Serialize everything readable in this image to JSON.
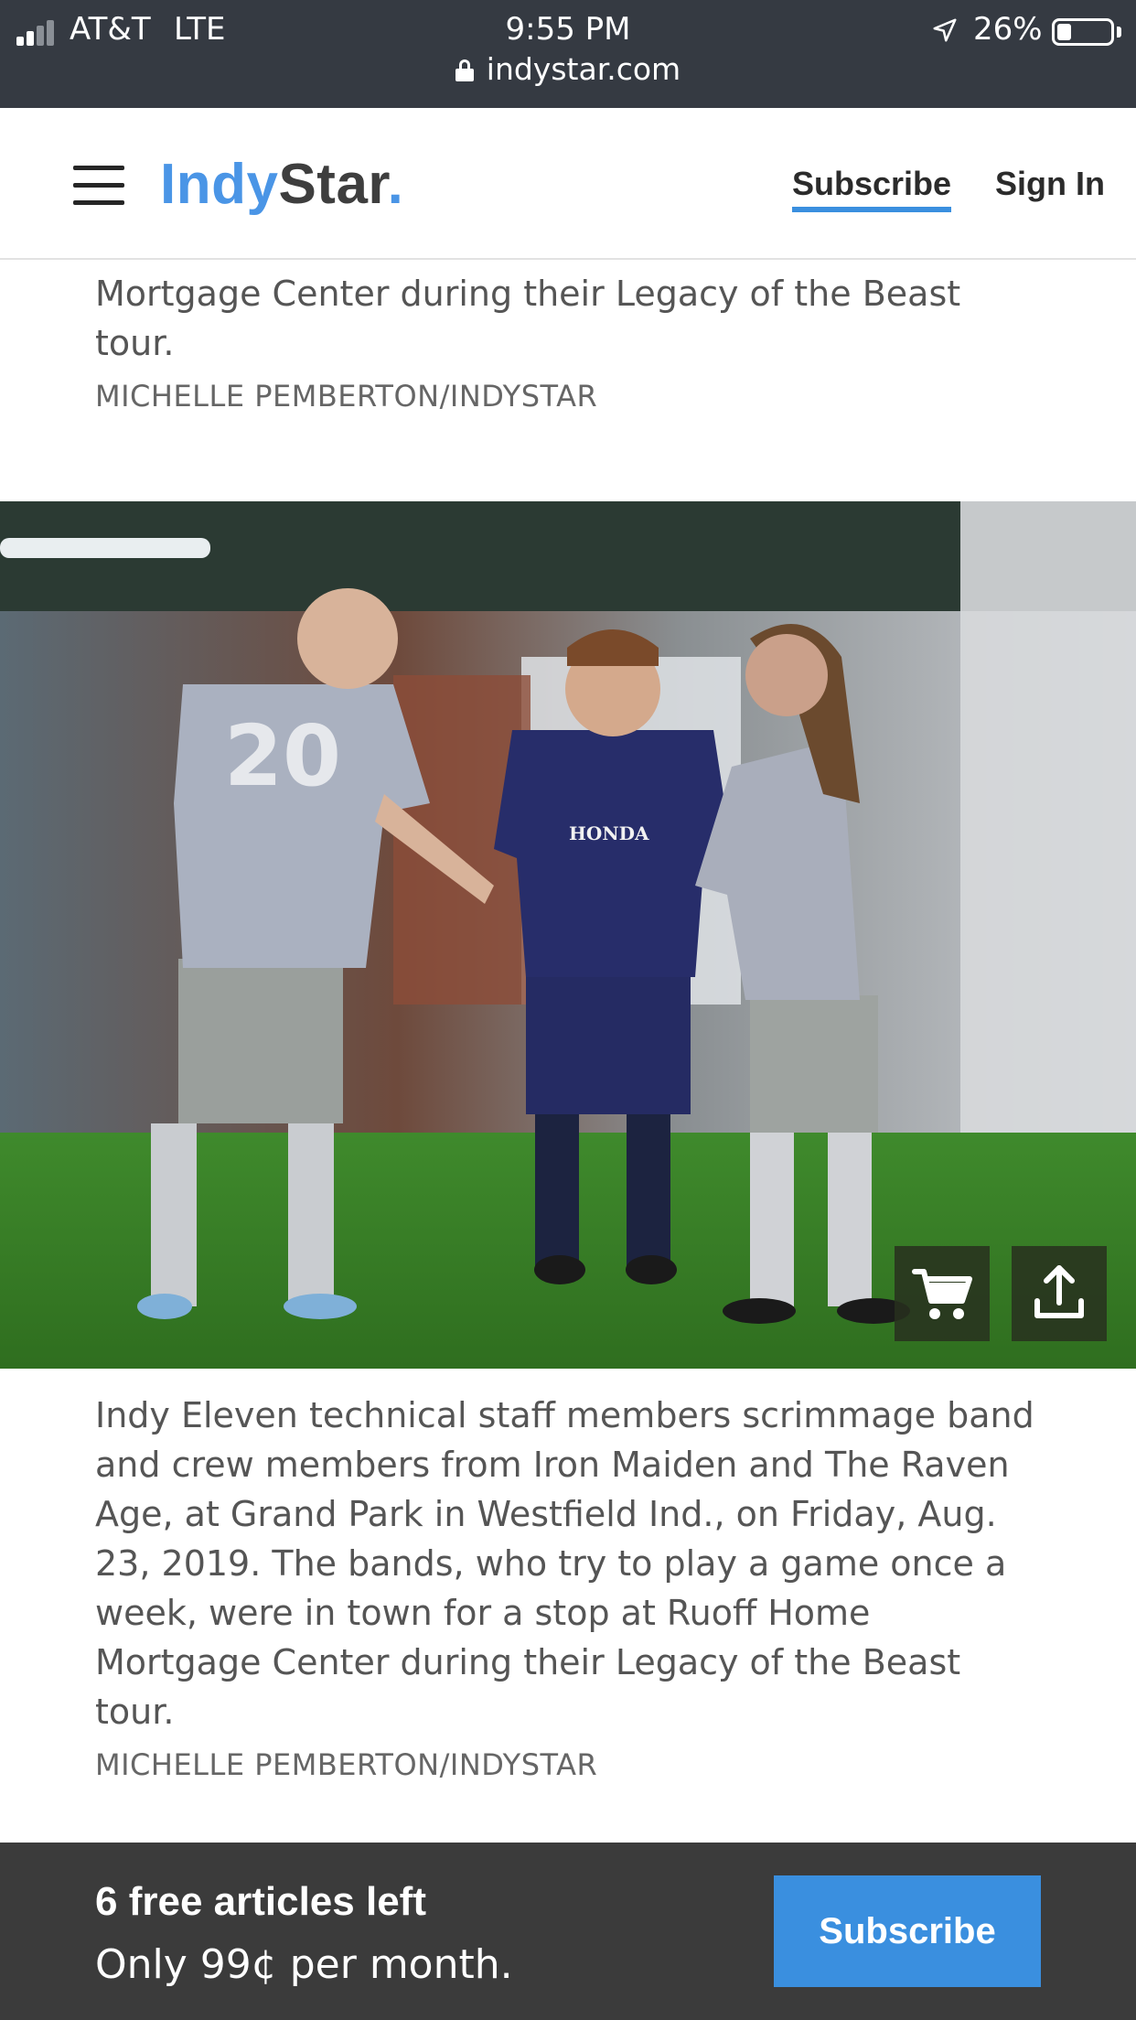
{
  "status_bar": {
    "carrier": "AT&T",
    "network": "LTE",
    "time": "9:55 PM",
    "battery_percent": "26%",
    "battery_level": 0.26,
    "signal_bars_active": 2,
    "signal_bars_total": 4
  },
  "browser": {
    "url": "indystar.com"
  },
  "header": {
    "logo_part1": "Indy",
    "logo_part2": "Star",
    "logo_dot": ".",
    "subscribe_label": "Subscribe",
    "signin_label": "Sign In"
  },
  "article": {
    "prev_caption_tail": "Mortgage Center during their Legacy of the Beast tour.",
    "prev_credit": "MICHELLE PEMBERTON/INDYSTAR",
    "photo": {
      "jersey_number": "20",
      "sponsor_text": "HONDA"
    },
    "caption": "Indy Eleven technical staff members scrimmage band and crew members from Iron Maiden and The Raven Age, at Grand Park in Westfield Ind., on Friday, Aug. 23, 2019. The bands, who try to play a game once a week, were in town for a stop at Ruoff Home Mortgage Center during their Legacy of the Beast tour.",
    "credit": "MICHELLE PEMBERTON/INDYSTAR"
  },
  "paywall": {
    "title": "6 free articles left",
    "subtitle": "Only 99¢ per month.",
    "button_label": "Subscribe"
  },
  "colors": {
    "brand_blue": "#4a95e6",
    "status_bar_bg": "#353a42",
    "paywall_bg": "#3b3b3b",
    "button_blue": "#3a8fdf"
  },
  "icons": {
    "menu": "menu-icon",
    "lock": "lock-icon",
    "location": "location-arrow-icon",
    "cart": "cart-icon",
    "share": "share-icon"
  }
}
